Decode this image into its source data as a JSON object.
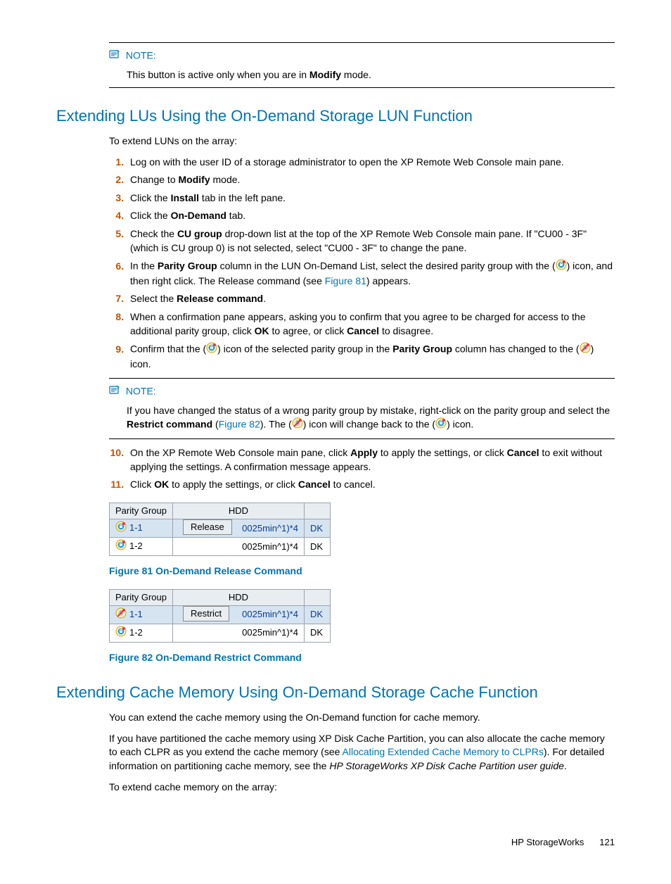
{
  "note1": {
    "label": "NOTE:",
    "text_a": "This button is active only when you are in ",
    "bold_a": "Modify",
    "text_b": " mode."
  },
  "h1": "Extending LUs Using the On-Demand Storage LUN Function",
  "intro1": "To extend LUNs on the array:",
  "steps": {
    "s1": "Log on with the user ID of a storage administrator to open the XP Remote Web Console main pane.",
    "s2a": "Change to ",
    "s2b": "Modify",
    "s2c": " mode.",
    "s3a": "Click the ",
    "s3b": "Install",
    "s3c": " tab in the left pane.",
    "s4a": "Click the ",
    "s4b": "On-Demand",
    "s4c": " tab.",
    "s5a": "Check the ",
    "s5b": "CU group",
    "s5c": " drop-down list at the top of the XP Remote Web Console main pane. If \"CU00 - 3F\" (which is CU group 0) is not selected, select \"CU00 - 3F\" to change the pane.",
    "s6a": "In the ",
    "s6b": "Parity Group",
    "s6c": " column in the LUN On-Demand List, select the desired parity group with the (",
    "s6d": ") icon, and then right click. The Release command (see ",
    "s6link": "Figure 81",
    "s6e": ") appears.",
    "s7a": "Select the ",
    "s7b": "Release command",
    "s7c": ".",
    "s8a": "When a confirmation pane appears, asking you to confirm that you agree to be charged for access to the additional parity group, click ",
    "s8b": "OK",
    "s8c": " to agree, or click ",
    "s8d": "Cancel",
    "s8e": " to disagree.",
    "s9a": "Confirm that the (",
    "s9b": ") icon of the selected parity group in the ",
    "s9c": "Parity Group",
    "s9d": " column has changed to the (",
    "s9e": ") icon.",
    "s10a": "On the XP Remote Web Console main pane, click ",
    "s10b": "Apply",
    "s10c": " to apply the settings, or click ",
    "s10d": "Cancel",
    "s10e": " to exit without applying the settings. A confirmation message appears.",
    "s11a": "Click ",
    "s11b": "OK",
    "s11c": " to apply the settings, or click ",
    "s11d": "Cancel",
    "s11e": " to cancel."
  },
  "note2": {
    "label": "NOTE:",
    "a": "If you have changed the status of a wrong parity group by mistake, right-click on the parity group and select the ",
    "b": "Restrict command",
    "c": " (",
    "link": "Figure 82",
    "d": "). The (",
    "e": ") icon will change back to the (",
    "f": ") icon."
  },
  "fig81": {
    "caption": "Figure 81 On-Demand Release Command",
    "th1": "Parity Group",
    "th2": "HDD",
    "r1c1": "1-1",
    "r1c2": "0025min^1)*4",
    "r1c3": "DK",
    "r2c1": "1-2",
    "r2c2": "0025min^1)*4",
    "r2c3": "DK",
    "btn": "Release"
  },
  "fig82": {
    "caption": "Figure 82 On-Demand Restrict Command",
    "th1": "Parity Group",
    "th2": "HDD",
    "r1c1": "1-1",
    "r1c2": "0025min^1)*4",
    "r1c3": "DK",
    "r2c1": "1-2",
    "r2c2": "0025min^1)*4",
    "r2c3": "DK",
    "btn": "Restrict"
  },
  "h2": "Extending Cache Memory Using On-Demand Storage Cache Function",
  "p1": "You can extend the cache memory using the On-Demand function for cache memory.",
  "p2a": "If you have partitioned the cache memory using XP Disk Cache Partition, you can also allocate the cache memory to each CLPR as you extend the cache memory (see ",
  "p2link": "Allocating Extended Cache Memory to CLPRs",
  "p2b": "). For detailed information on partitioning cache memory, see the ",
  "p2i": "HP StorageWorks XP Disk Cache Partition user guide",
  "p2c": ".",
  "p3": "To extend cache memory on the array:",
  "footer": {
    "label": "HP StorageWorks",
    "page": "121"
  }
}
